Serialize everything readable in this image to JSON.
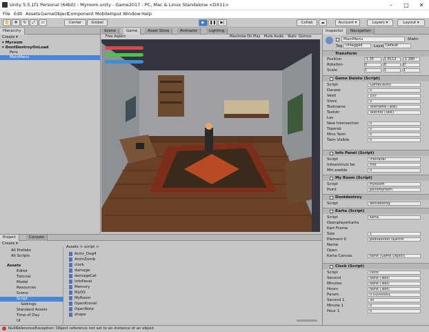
{
  "window": {
    "title": "Unity 5.5.1f1 Personal (64bit) - Myroom.unity - Game2017 - PC, Mac & Linux Standalone <DX11>"
  },
  "menu": [
    "File",
    "Edit",
    "Assets",
    "GameObject",
    "Component",
    "MobileInput",
    "Window",
    "Help"
  ],
  "toolbar": {
    "center": "Center",
    "global": "Global",
    "collab": "Collab",
    "account": "Account",
    "layers": "Layers",
    "layout": "Layout"
  },
  "hierarchy": {
    "tab": "Hierarchy",
    "create": "Create",
    "scene": "Myroom",
    "ddol": "DontDestroyOnLoad",
    "items": [
      "Pers",
      "MainMenu"
    ]
  },
  "center_tabs": [
    "Scene",
    "Game",
    "Asset Store",
    "Animator",
    "Lighting"
  ],
  "game_bar": {
    "display": "Free Aspect",
    "maximize": "Maximize On Play",
    "mute": "Mute Audio",
    "stats": "Stats",
    "gizmos": "Gizmos"
  },
  "project": {
    "tab": "Project",
    "console_tab": "Console",
    "create": "Create",
    "favorites": [
      "All Prefabs",
      "All Scripts"
    ],
    "tree": [
      "Assets",
      "Editor",
      "Tutorial",
      "Model",
      "Resources",
      "Scene",
      "Script",
      "Settings",
      "Standard Assets",
      "Time of Day",
      "UI"
    ],
    "breadcrumb": "Assets > script >",
    "files": [
      "Anim_Dog4",
      "AnimZomb",
      "clock",
      "damage",
      "damageCat",
      "InfoPanel",
      "Memory",
      "MyOS",
      "MyRoom",
      "OpenKrovat",
      "OpenNote",
      "shape"
    ]
  },
  "status": {
    "message": "NullReferenceException: Object reference not set to an instance of an object"
  },
  "inspector": {
    "tab": "Inspector",
    "nav_tab": "Navigation",
    "object": "MainMenu",
    "static": "Static",
    "tag_label": "Tag",
    "tag": "Untagged",
    "layer_label": "Layer",
    "layer": "Default",
    "transform": {
      "title": "Transform",
      "position": {
        "label": "Position",
        "x": "-1.35",
        "y": "1.8112",
        "z": "-2.280"
      },
      "rotation": {
        "label": "Rotation",
        "x": "0",
        "y": "0",
        "z": "0"
      },
      "scale": {
        "label": "Scale",
        "x": "1",
        "y": "1",
        "z": "1"
      }
    },
    "game_data": {
      "title": "Game Daistu (Script)",
      "rows": [
        [
          "Script",
          "GameDaistu"
        ],
        [
          "Daraxe",
          "0"
        ],
        [
          "Vesti",
          "100"
        ],
        [
          "Store",
          "0"
        ],
        [
          "Textname",
          "Textname (Text)"
        ],
        [
          "Textstr",
          "Textinfo (Text)"
        ],
        [
          "Las",
          ""
        ],
        [
          "New Intersection",
          "0"
        ],
        [
          "Tsporsb",
          "0"
        ],
        [
          "Mins Taim",
          "0"
        ],
        [
          "Taim Visible",
          "0"
        ]
      ]
    },
    "info_panel": {
      "title": "Info Panel (Script)",
      "rows": [
        [
          "Script",
          "InfoPanel"
        ],
        [
          "Infoanimviz be",
          "info"
        ],
        [
          "Min.ezeble",
          "0"
        ]
      ]
    },
    "my_room": {
      "title": "My Room (Script)",
      "rows": [
        [
          "Script",
          "MyRoom"
        ],
        [
          "Point",
          "pointMyroom"
        ]
      ]
    },
    "dont_destroy": {
      "title": "Dontdestroy",
      "rows": [
        [
          "Script",
          "dontdestroy"
        ]
      ]
    },
    "karta": {
      "title": "Karta (Script)",
      "rows": [
        [
          "Script",
          "karta"
        ],
        [
          "Openplayerkarta",
          ""
        ],
        [
          "Kart Frame",
          ""
        ],
        [
          "Size",
          "1"
        ],
        [
          "Element 0",
          "podvalkrest (KartIm"
        ],
        [
          "Name",
          ""
        ],
        [
          "Open",
          ""
        ],
        [
          "Karta Canvas",
          "None (Game Object)"
        ]
      ]
    },
    "clock": {
      "title": "Clock (Script)",
      "rows": [
        [
          "Script",
          "clock"
        ],
        [
          "Second",
          "None (Text)"
        ],
        [
          "Minutes",
          "None (Text)"
        ],
        [
          "Hours",
          "None (Text)"
        ],
        [
          "Param",
          "0.01000001"
        ],
        [
          "Second 1",
          "30"
        ],
        [
          "Minute 1",
          "0"
        ],
        [
          "Hour 1",
          "0"
        ]
      ]
    }
  },
  "bars": {
    "colors": [
      "#d94848",
      "#4ec24e",
      "#3a8fd6"
    ]
  }
}
